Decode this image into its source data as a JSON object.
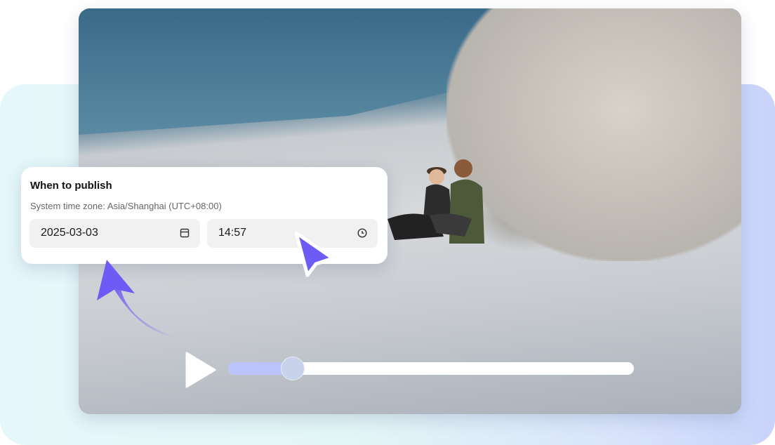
{
  "publish_card": {
    "title": "When to publish",
    "timezone_label": "System time zone: Asia/Shanghai (UTC+08:00)",
    "date_value": "2025-03-03",
    "time_value": "14:57",
    "date_icon": "calendar-icon",
    "time_icon": "clock-icon"
  },
  "player": {
    "play_icon": "play-icon",
    "progress": 0.16
  },
  "colors": {
    "accent": "#6c5cf5",
    "progress_fill": "#bcc3fa"
  }
}
